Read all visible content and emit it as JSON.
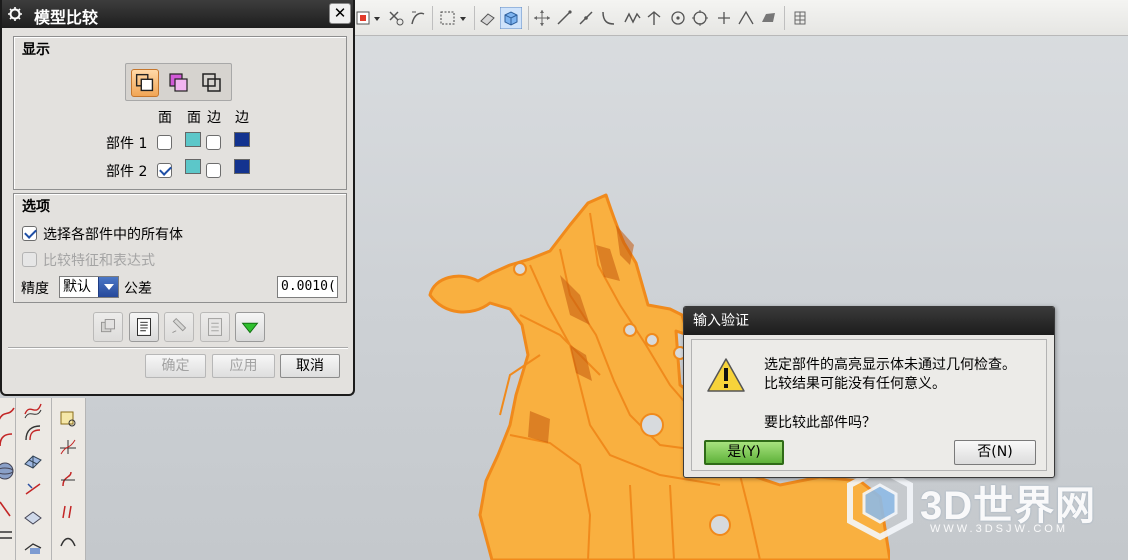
{
  "model_compare_dialog": {
    "title": "模型比较",
    "display_group": {
      "heading": "显示",
      "column_headers": [
        "面",
        "面",
        "边",
        "边"
      ],
      "rows": [
        {
          "label": "部件 1",
          "face_checked": false
        },
        {
          "label": "部件 2",
          "face_checked": true
        }
      ]
    },
    "options_group": {
      "heading": "选项",
      "select_all_bodies_label": "选择各部件中的所有体",
      "select_all_bodies_checked": true,
      "compare_features_label": "比较特征和表达式",
      "compare_features_checked": false,
      "precision_label": "精度",
      "precision_value": "默认",
      "tolerance_label": "公差",
      "tolerance_value": "0.0010("
    },
    "buttons": {
      "ok": "确定",
      "apply": "应用",
      "cancel": "取消"
    }
  },
  "validation_dialog": {
    "title": "输入验证",
    "message_line1": "选定部件的高亮显示体未通过几何检查。",
    "message_line2": "比较结果可能没有任何意义。",
    "question": "要比较此部件吗？",
    "yes_label": "是(Y)",
    "no_label": "否(N)"
  },
  "watermark": {
    "brand": "3D世界网",
    "url": "WWW.3DSJW.COM"
  },
  "colors": {
    "part_orange": "#f9b040",
    "part_edge": "#f08a1c",
    "face_cyan": "#5cc7c9",
    "edge_blue": "#13338f",
    "yes_green": "#5fb23a"
  }
}
